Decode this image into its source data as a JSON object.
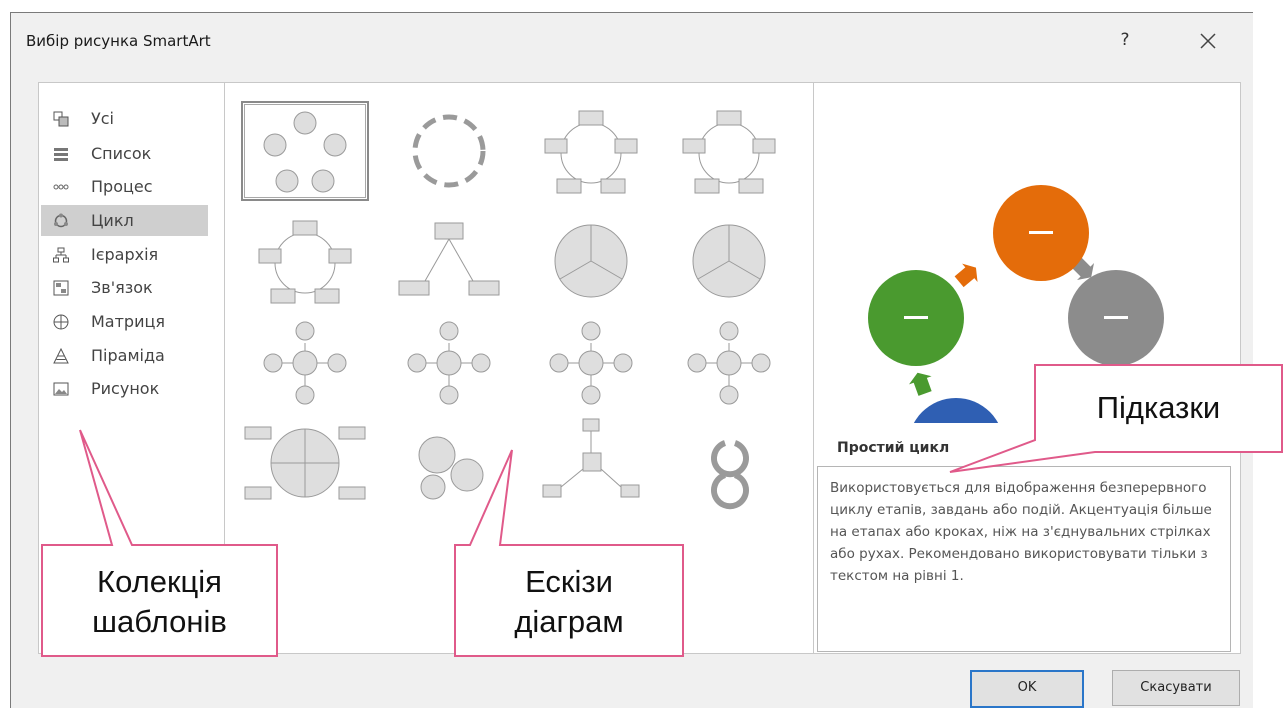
{
  "dialog": {
    "title": "Вибір рисунка SmartArt",
    "help_label": "?",
    "ok_label": "OK",
    "cancel_label": "Скасувати"
  },
  "categories": [
    {
      "label": "Усі",
      "icon": "all-icon",
      "selected": false
    },
    {
      "label": "Список",
      "icon": "list-icon",
      "selected": false
    },
    {
      "label": "Процес",
      "icon": "process-icon",
      "selected": false
    },
    {
      "label": "Цикл",
      "icon": "cycle-icon",
      "selected": true
    },
    {
      "label": "Ієрархія",
      "icon": "hierarchy-icon",
      "selected": false
    },
    {
      "label": "Зв'язок",
      "icon": "relationship-icon",
      "selected": false
    },
    {
      "label": "Матриця",
      "icon": "matrix-icon",
      "selected": false
    },
    {
      "label": "Піраміда",
      "icon": "pyramid-icon",
      "selected": false
    },
    {
      "label": "Рисунок",
      "icon": "picture-icon",
      "selected": false
    }
  ],
  "thumbnails": [
    "simple-cycle",
    "text-cycle",
    "block-cycle",
    "nondirectional-cycle",
    "continuous-cycle",
    "multidirectional-cycle",
    "segmented-cycle",
    "basic-pie",
    "radial-cycle",
    "basic-radial",
    "diverging-radial",
    "radial-cluster",
    "cycle-matrix",
    "gear",
    "radial-list",
    "circle-arrows"
  ],
  "preview": {
    "title": "Простий цикл",
    "description": "Використовується для відображення безперервного циклу етапів, завдань або подій. Акцентуація більше на етапах або кроках, ніж на з'єднувальних стрілках або рухах. Рекомендовано використовувати тільки з текстом на рівні 1.",
    "node_colors": [
      "#e46c0a",
      "#8c8c8c",
      "#f2b50c",
      "#2f5fb3",
      "#4a9a2f"
    ]
  },
  "callouts": {
    "templates": [
      "Колекція",
      "шаблонів"
    ],
    "sketches": [
      "Ескізи",
      "діаграм"
    ],
    "hints": "Підказки"
  }
}
